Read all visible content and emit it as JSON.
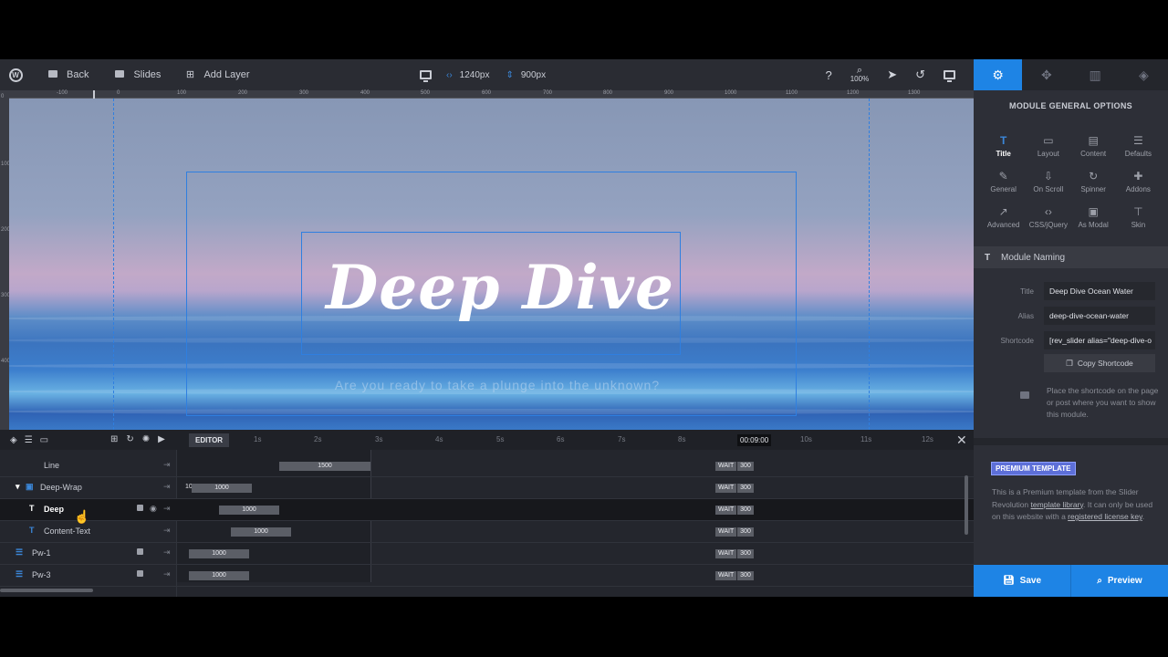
{
  "toolbar": {
    "back_label": "Back",
    "slides_label": "Slides",
    "add_layer_label": "Add Layer",
    "width_value": "1240px",
    "height_value": "900px",
    "zoom_value": "100%"
  },
  "ruler": {
    "top_labels": [
      "-100",
      "0",
      "100",
      "200",
      "300",
      "400",
      "500",
      "600",
      "700",
      "800",
      "900",
      "1000",
      "1100",
      "1200",
      "1300"
    ],
    "left_labels": [
      "0",
      "100",
      "200",
      "300",
      "400"
    ]
  },
  "canvas": {
    "title": "Deep Dive",
    "subtitle": "Are you ready to take a plunge into the unknown?"
  },
  "timeline": {
    "editor_label": "EDITOR",
    "ticks": [
      "1s",
      "2s",
      "3s",
      "4s",
      "5s",
      "6s",
      "7s",
      "8s",
      "10s",
      "11s",
      "12s"
    ],
    "current_time": "00:09:00",
    "rows": [
      {
        "name": "Line",
        "bar_value": "1500",
        "wait": "WAIT",
        "wait_value": "300"
      },
      {
        "name": "Deep-Wrap",
        "pre_value": "10",
        "bar_value": "1000",
        "wait": "WAIT",
        "wait_value": "300"
      },
      {
        "name": "Deep",
        "bar_value": "1000",
        "wait": "WAIT",
        "wait_value": "300"
      },
      {
        "name": "Content-Text",
        "bar_value": "1000",
        "wait": "WAIT",
        "wait_value": "300"
      },
      {
        "name": "Pw-1",
        "bar_value": "1000",
        "wait": "WAIT",
        "wait_value": "300"
      },
      {
        "name": "Pw-3",
        "bar_value": "1000",
        "wait": "WAIT",
        "wait_value": "300"
      }
    ]
  },
  "right_panel": {
    "header": "MODULE GENERAL OPTIONS",
    "options": [
      {
        "label": "Title",
        "icon": "T"
      },
      {
        "label": "Layout",
        "icon": "▭"
      },
      {
        "label": "Content",
        "icon": "▤"
      },
      {
        "label": "Defaults",
        "icon": "☰"
      },
      {
        "label": "General",
        "icon": "✎"
      },
      {
        "label": "On Scroll",
        "icon": "⇩"
      },
      {
        "label": "Spinner",
        "icon": "↻"
      },
      {
        "label": "Addons",
        "icon": "✚"
      },
      {
        "label": "Advanced",
        "icon": "↗"
      },
      {
        "label": "CSS/jQuery",
        "icon": "‹›"
      },
      {
        "label": "As Modal",
        "icon": "▣"
      },
      {
        "label": "Skin",
        "icon": "⊤"
      }
    ],
    "section_title": "Module Naming",
    "title_label": "Title",
    "title_value": "Deep Dive Ocean Water",
    "alias_label": "Alias",
    "alias_value": "deep-dive-ocean-water",
    "shortcode_label": "Shortcode",
    "shortcode_value": "[rev_slider alias=\"deep-dive-o",
    "copy_button": "Copy Shortcode",
    "hint": "Place the shortcode on the page or post where you want to show this module.",
    "premium_badge": "PREMIUM TEMPLATE",
    "premium_text_1": "This is a Premium template from the Slider Revolution ",
    "premium_link_1": "template library",
    "premium_text_2": ". It can only be used on this website with a ",
    "premium_link_2": "registered license key",
    "premium_text_3": "."
  },
  "footer": {
    "save_label": "Save",
    "preview_label": "Preview"
  },
  "colors": {
    "accent": "#1e84e5",
    "guide": "#2f7fe0",
    "panel_bg": "#2d2f37"
  }
}
